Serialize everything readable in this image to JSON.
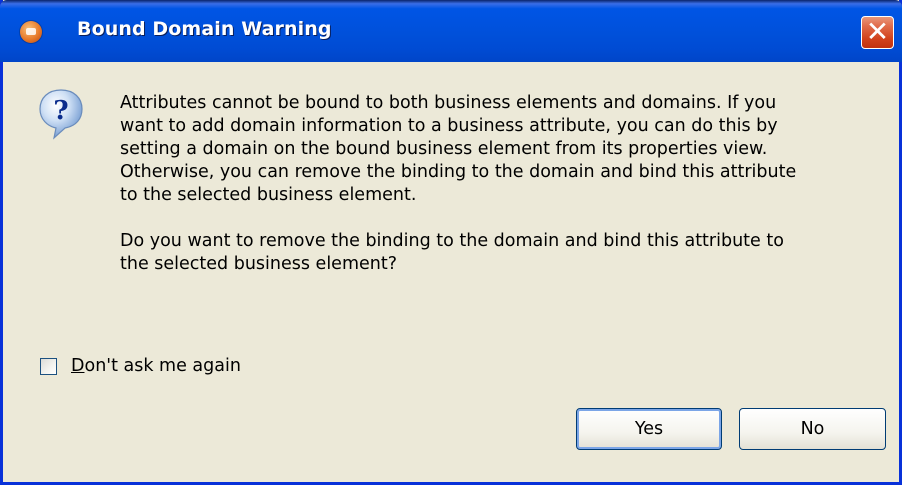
{
  "window": {
    "title": "Bound Domain Warning",
    "title_icon": "app-icon",
    "close_glyph": "✕"
  },
  "icon": {
    "type": "question-icon",
    "glyph": "?"
  },
  "message": {
    "paragraph1": "Attributes cannot be bound to both business elements and domains. If you\nwant to add domain information to a business attribute, you can do this by\nsetting a domain on the bound business element from its properties view.\nOtherwise, you can remove the binding to the domain and bind this attribute\nto the selected business element.",
    "paragraph2": "Do you want to remove the binding to the domain and bind this attribute to\nthe selected business element?"
  },
  "checkbox": {
    "label_mnemonic": "D",
    "label_rest": "on't ask me again",
    "checked": false
  },
  "buttons": {
    "yes_label": "Yes",
    "no_label": "No"
  },
  "colors": {
    "titlebar": "#0055E5",
    "dialog_bg": "#ECE9D8",
    "close_button": "#D2421C",
    "default_button_focus": "#7BA5E7"
  }
}
